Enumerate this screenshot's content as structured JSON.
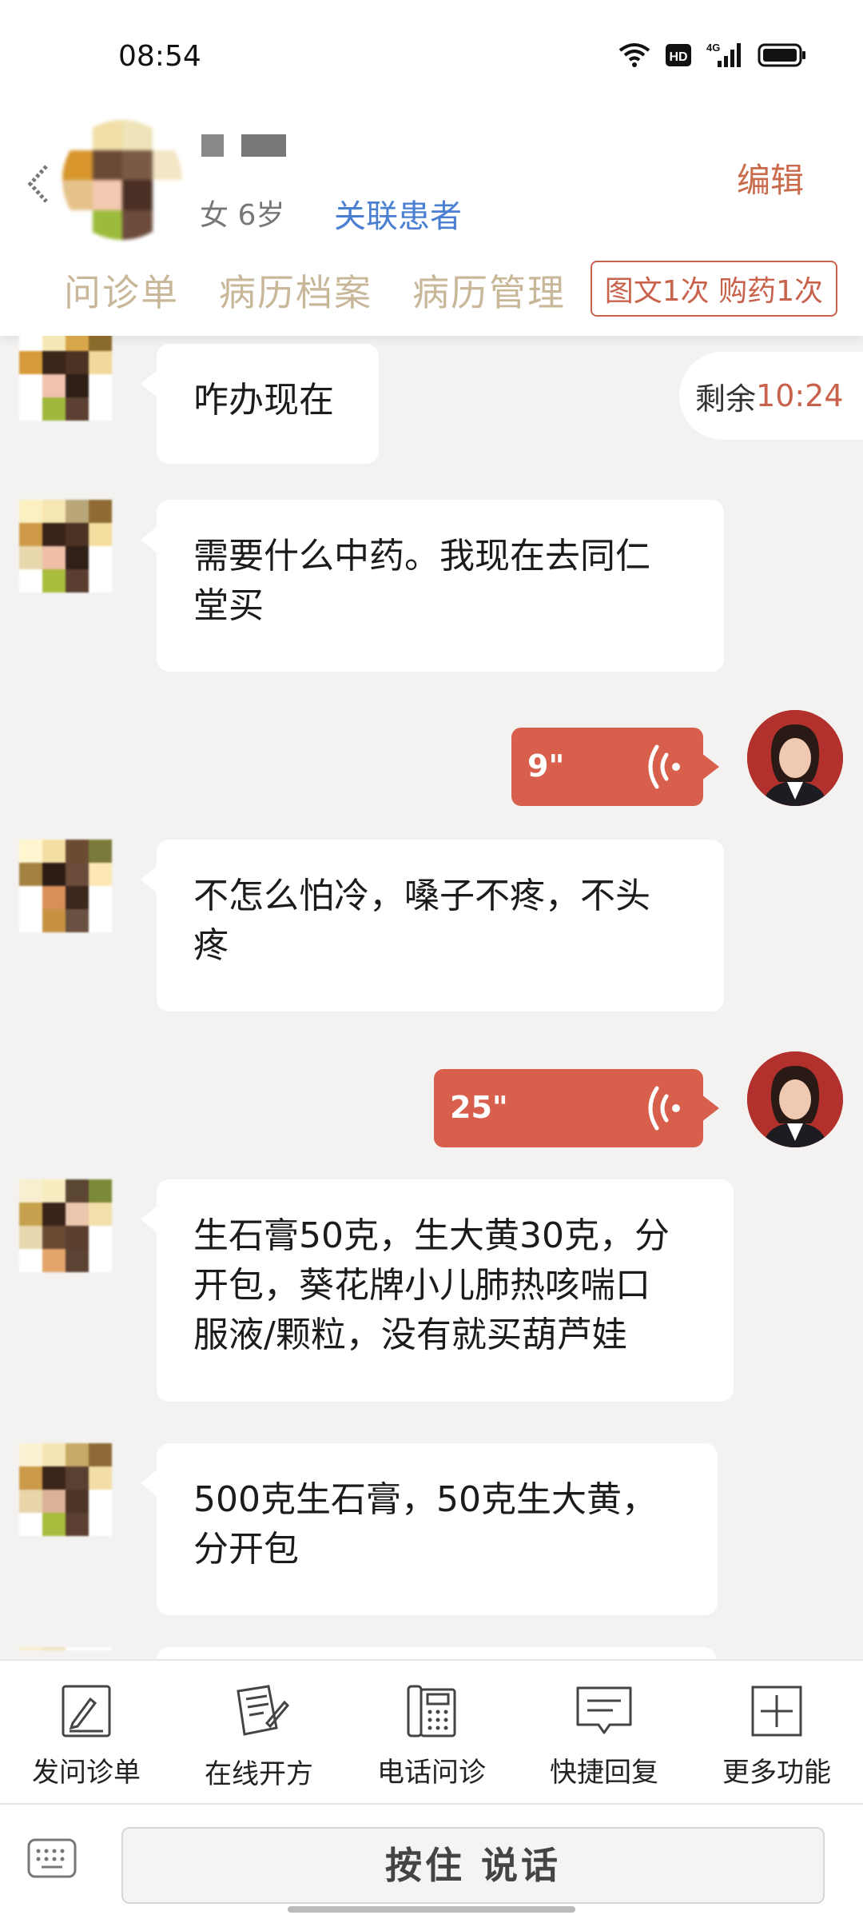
{
  "status_bar": {
    "time": "08:54",
    "icons": [
      "wifi-icon",
      "hd-icon",
      "4g-signal-icon",
      "battery-icon"
    ],
    "network": "4G",
    "hd": "HD"
  },
  "header": {
    "patient_info": "女 6岁",
    "link_patient": "关联患者",
    "edit": "编辑",
    "tabs": [
      "问诊单",
      "病历档案",
      "病历管理"
    ],
    "quota": "图文1次 购药1次"
  },
  "chat": {
    "remaining_label": "剩余",
    "remaining_time": "10:24",
    "messages": [
      {
        "from": "patient",
        "type": "text",
        "text": "咋办现在"
      },
      {
        "from": "patient",
        "type": "text",
        "lines": [
          "需要什么中药。我现在去同仁",
          "堂买"
        ]
      },
      {
        "from": "doctor",
        "type": "voice",
        "duration": "9\""
      },
      {
        "from": "patient",
        "type": "text",
        "lines": [
          "不怎么怕冷，嗓子不疼，不头",
          "疼"
        ]
      },
      {
        "from": "doctor",
        "type": "voice",
        "duration": "25\""
      },
      {
        "from": "patient",
        "type": "text",
        "lines": [
          "生石膏50克，生大黄30克，分",
          "开包，葵花牌小儿肺热咳喘口",
          "服液/颗粒，没有就买葫芦娃"
        ]
      },
      {
        "from": "patient",
        "type": "text",
        "lines": [
          "500克生石膏，50克生大黄，",
          "分开包"
        ]
      }
    ]
  },
  "toolbar": {
    "items": [
      {
        "label": "发问诊单",
        "icon": "form-icon"
      },
      {
        "label": "在线开方",
        "icon": "prescription-icon"
      },
      {
        "label": "电话问诊",
        "icon": "phone-icon"
      },
      {
        "label": "快捷回复",
        "icon": "quick-reply-icon"
      },
      {
        "label": "更多功能",
        "icon": "plus-box-icon"
      }
    ]
  },
  "input": {
    "hold_to_talk": "按住 说话"
  },
  "colors": {
    "accent": "#d85f4b",
    "tab_text": "#c9b79a",
    "link": "#4b7fd2",
    "background": "#f3f2f1"
  }
}
